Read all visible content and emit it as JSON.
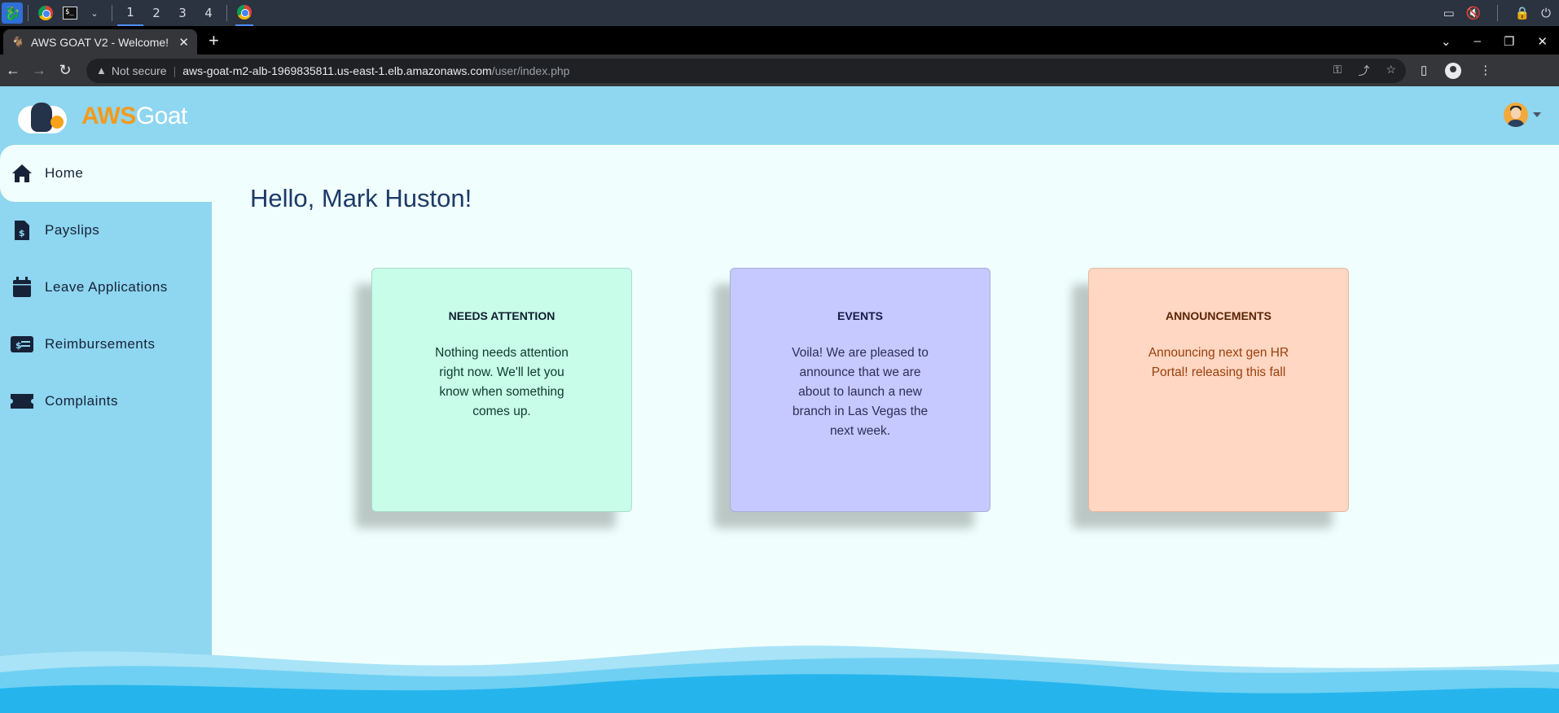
{
  "os": {
    "workspaces": [
      "1",
      "2",
      "3",
      "4"
    ],
    "active_workspace": "1"
  },
  "browser": {
    "tab_title": "AWS GOAT V2 - Welcome!",
    "security_label": "Not secure",
    "url_host": "aws-goat-m2-alb-1969835811.us-east-1.elb.amazonaws.com",
    "url_path": "/user/index.php"
  },
  "app": {
    "brand_aws": "AWS",
    "brand_goat": "Goat",
    "greeting": "Hello, Mark Huston!",
    "sidebar": {
      "items": [
        {
          "label": "Home",
          "icon": "home-icon",
          "active": true
        },
        {
          "label": "Payslips",
          "icon": "invoice-dollar-icon"
        },
        {
          "label": "Leave Applications",
          "icon": "calendar-icon"
        },
        {
          "label": "Reimbursements",
          "icon": "money-check-icon"
        },
        {
          "label": "Complaints",
          "icon": "ticket-icon"
        }
      ]
    },
    "cards": [
      {
        "title": "NEEDS ATTENTION",
        "body": "Nothing needs attention right now. We'll let you know when something comes up.",
        "color": "#c8fde9"
      },
      {
        "title": "EVENTS",
        "body": "Voila! We are pleased to announce that we are about to launch a new branch in Las Vegas the next week.",
        "color": "#c6c9ff"
      },
      {
        "title": "ANNOUNCEMENTS",
        "body": "Announcing next gen HR Portal! releasing this fall",
        "color": "#ffd7c2"
      }
    ],
    "colors": {
      "header_bg": "#8fd6f0",
      "content_bg": "#f0fffd",
      "brand_orange": "#f39a1c",
      "wave_blue": "#25b5ec"
    }
  }
}
